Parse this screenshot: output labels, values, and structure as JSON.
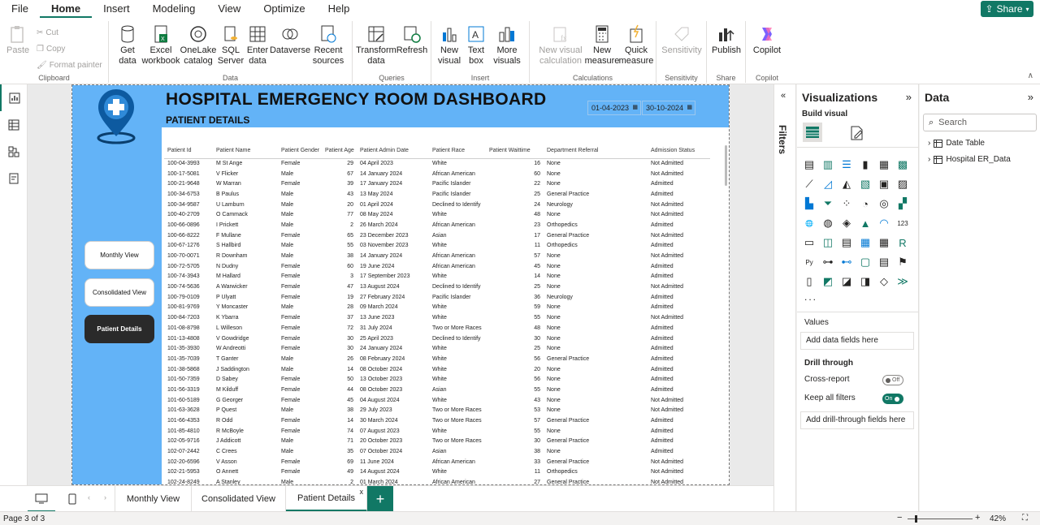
{
  "menu": [
    "File",
    "Home",
    "Insert",
    "Modeling",
    "View",
    "Optimize",
    "Help"
  ],
  "share_label": "Share",
  "ribbon": {
    "clipboard": {
      "paste": "Paste",
      "cut": "Cut",
      "copy": "Copy",
      "format_painter": "Format painter",
      "group": "Clipboard"
    },
    "data": {
      "get_data": "Get data",
      "excel": "Excel workbook",
      "onelake": "OneLake catalog",
      "sql": "SQL Server",
      "enter": "Enter data",
      "dataverse": "Dataverse",
      "recent": "Recent sources",
      "group": "Data"
    },
    "queries": {
      "transform": "Transform data",
      "refresh": "Refresh",
      "group": "Queries"
    },
    "insert": {
      "new_visual": "New visual",
      "text_box": "Text box",
      "more_visuals": "More visuals",
      "group": "Insert"
    },
    "calculations": {
      "new_visual_calc": "New visual calculation",
      "new_measure": "New measure",
      "quick_measure": "Quick measure",
      "group": "Calculations"
    },
    "sensitivity": {
      "label": "Sensitivity",
      "group": "Sensitivity"
    },
    "share": {
      "publish": "Publish",
      "group": "Share"
    },
    "copilot": {
      "label": "Copilot",
      "group": "Copilot"
    }
  },
  "dashboard": {
    "title": "HOSPITAL EMERGENCY ROOM DASHBOARD",
    "subtitle": "PATIENT DETAILS",
    "date_from": "01-04-2023",
    "date_to": "30-10-2024",
    "nav": [
      "Monthly View",
      "Consolidated View",
      "Patient Details"
    ],
    "columns": [
      "Patient Id",
      "Patient Name",
      "Patient Gender",
      "Patient Age",
      "Patient Admin Date",
      "Patient Race",
      "Patient Waittime",
      "Department Referral",
      "Admission Status"
    ],
    "rows": [
      [
        "100-04-3993",
        "M St Ange",
        "Female",
        "29",
        "04 April 2023",
        "White",
        "16",
        "None",
        "Not Admitted"
      ],
      [
        "100-17-5081",
        "V Flicker",
        "Male",
        "67",
        "14 January 2024",
        "African American",
        "60",
        "None",
        "Not Admitted"
      ],
      [
        "100-21-9648",
        "W Marran",
        "Female",
        "39",
        "17 January 2024",
        "Pacific Islander",
        "22",
        "None",
        "Admitted"
      ],
      [
        "100-34-6753",
        "B Paulus",
        "Male",
        "43",
        "13 May 2024",
        "Pacific Islander",
        "25",
        "General Practice",
        "Admitted"
      ],
      [
        "100-34-9587",
        "U Lamburn",
        "Male",
        "20",
        "01 April 2024",
        "Declined to Identify",
        "24",
        "Neurology",
        "Not Admitted"
      ],
      [
        "100-40-2709",
        "O Cammack",
        "Male",
        "77",
        "08 May 2024",
        "White",
        "48",
        "None",
        "Not Admitted"
      ],
      [
        "100-66-0896",
        "I Prickett",
        "Male",
        "2",
        "26 March 2024",
        "African American",
        "23",
        "Orthopedics",
        "Admitted"
      ],
      [
        "100-66-8222",
        "F Mullane",
        "Female",
        "65",
        "23 December 2023",
        "Asian",
        "17",
        "General Practice",
        "Not Admitted"
      ],
      [
        "100-67-1276",
        "S Hallbird",
        "Male",
        "55",
        "03 November 2023",
        "White",
        "11",
        "Orthopedics",
        "Admitted"
      ],
      [
        "100-70-0071",
        "R Downham",
        "Male",
        "38",
        "14 January 2024",
        "African American",
        "57",
        "None",
        "Not Admitted"
      ],
      [
        "100-72-5705",
        "N Dudny",
        "Female",
        "60",
        "19 June 2024",
        "African American",
        "45",
        "None",
        "Admitted"
      ],
      [
        "100-74-3943",
        "M Hallard",
        "Female",
        "3",
        "17 September 2023",
        "White",
        "14",
        "None",
        "Admitted"
      ],
      [
        "100-74-5636",
        "A Warwicker",
        "Female",
        "47",
        "13 August 2024",
        "Declined to Identify",
        "25",
        "None",
        "Not Admitted"
      ],
      [
        "100-79-0109",
        "P Ulyatt",
        "Female",
        "19",
        "27 February 2024",
        "Pacific Islander",
        "36",
        "Neurology",
        "Admitted"
      ],
      [
        "100-81-9769",
        "Y Moncaster",
        "Male",
        "28",
        "09 March 2024",
        "White",
        "59",
        "None",
        "Admitted"
      ],
      [
        "100-84-7203",
        "K Ybarra",
        "Female",
        "37",
        "13 June 2023",
        "White",
        "55",
        "None",
        "Not Admitted"
      ],
      [
        "101-08-8798",
        "L Willeson",
        "Female",
        "72",
        "31 July 2024",
        "Two or More Races",
        "48",
        "None",
        "Admitted"
      ],
      [
        "101-13-4808",
        "V Gowdridge",
        "Female",
        "30",
        "25 April 2023",
        "Declined to Identify",
        "30",
        "None",
        "Admitted"
      ],
      [
        "101-35-3930",
        "W Andreotti",
        "Female",
        "30",
        "24 January 2024",
        "White",
        "25",
        "None",
        "Admitted"
      ],
      [
        "101-35-7039",
        "T Ganter",
        "Male",
        "26",
        "08 February 2024",
        "White",
        "56",
        "General Practice",
        "Admitted"
      ],
      [
        "101-38-5868",
        "J Saddington",
        "Male",
        "14",
        "08 October 2024",
        "White",
        "20",
        "None",
        "Admitted"
      ],
      [
        "101-50-7359",
        "D Sabey",
        "Female",
        "50",
        "13 October 2023",
        "White",
        "56",
        "None",
        "Admitted"
      ],
      [
        "101-56-3319",
        "M Kilduff",
        "Female",
        "44",
        "08 October 2023",
        "Asian",
        "55",
        "None",
        "Admitted"
      ],
      [
        "101-60-5189",
        "G Georger",
        "Female",
        "45",
        "04 August 2024",
        "White",
        "43",
        "None",
        "Not Admitted"
      ],
      [
        "101-63-3628",
        "P Quest",
        "Male",
        "38",
        "29 July 2023",
        "Two or More Races",
        "53",
        "None",
        "Not Admitted"
      ],
      [
        "101-66-4353",
        "R Odd",
        "Female",
        "14",
        "30 March 2024",
        "Two or More Races",
        "57",
        "General Practice",
        "Admitted"
      ],
      [
        "101-85-4810",
        "R McBoyle",
        "Female",
        "74",
        "07 August 2023",
        "White",
        "55",
        "None",
        "Admitted"
      ],
      [
        "102-05-9716",
        "J Addicott",
        "Male",
        "71",
        "20 October 2023",
        "Two or More Races",
        "30",
        "General Practice",
        "Admitted"
      ],
      [
        "102-07-2442",
        "C Crees",
        "Male",
        "35",
        "07 October 2024",
        "Asian",
        "38",
        "None",
        "Admitted"
      ],
      [
        "102-20-6596",
        "V Asson",
        "Female",
        "69",
        "11 June 2024",
        "African American",
        "33",
        "General Practice",
        "Not Admitted"
      ],
      [
        "102-21-5953",
        "O Annett",
        "Female",
        "49",
        "14 August 2024",
        "White",
        "11",
        "Orthopedics",
        "Not Admitted"
      ],
      [
        "102-24-8249",
        "A Stanley",
        "Male",
        "2",
        "01 March 2024",
        "African American",
        "27",
        "General Practice",
        "Not Admitted"
      ]
    ]
  },
  "filters_label": "Filters",
  "viz": {
    "title": "Visualizations",
    "build_visual": "Build visual",
    "more": "...",
    "values": "Values",
    "add_data": "Add data fields here",
    "drill_through": "Drill through",
    "cross_report": "Cross-report",
    "cross_report_state": "Off",
    "keep_filters": "Keep all filters",
    "keep_filters_state": "On",
    "add_drill": "Add drill-through fields here"
  },
  "data_pane": {
    "title": "Data",
    "search_placeholder": "Search",
    "tables": [
      "Date Table",
      "Hospital ER_Data"
    ]
  },
  "page_tabs": [
    "Monthly View",
    "Consolidated View",
    "Patient Details"
  ],
  "add_page": "+",
  "status": {
    "page": "Page 3 of 3",
    "zoom": "42%"
  }
}
